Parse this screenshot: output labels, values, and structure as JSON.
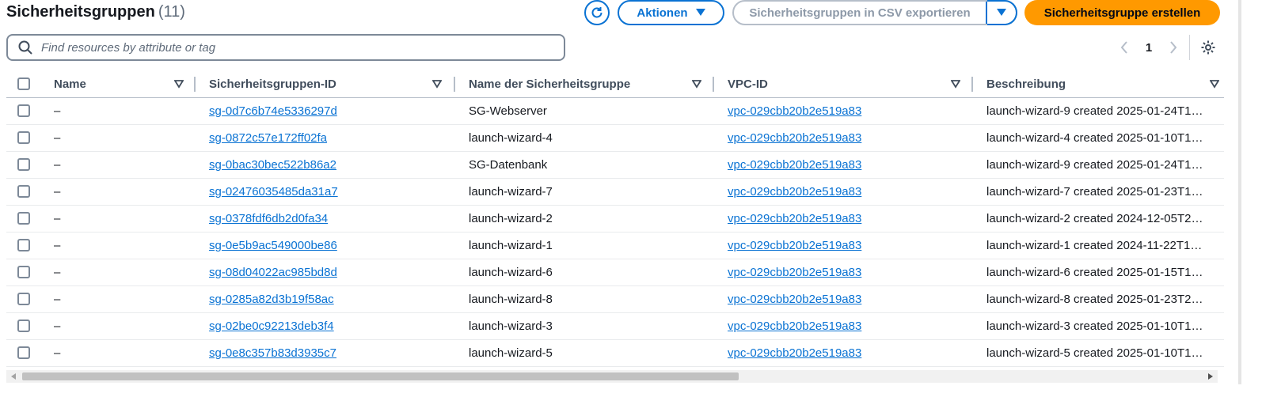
{
  "header": {
    "title": "Sicherheitsgruppen",
    "count": "(11)",
    "actions_label": "Aktionen",
    "export_label": "Sicherheitsgruppen in CSV exportieren",
    "create_label": "Sicherheitsgruppe erstellen"
  },
  "search": {
    "placeholder": "Find resources by attribute or tag"
  },
  "pagination": {
    "current_page": "1"
  },
  "columns": {
    "name": "Name",
    "sg_id": "Sicherheitsgruppen-ID",
    "sg_name": "Name der Sicherheitsgruppe",
    "vpc_id": "VPC-ID",
    "description": "Beschreibung"
  },
  "rows": [
    {
      "name": "–",
      "sg_id": "sg-0d7c6b74e5336297d",
      "sg_name": "SG-Webserver",
      "vpc_id": "vpc-029cbb20b2e519a83",
      "description": "launch-wizard-9 created 2025-01-24T1…"
    },
    {
      "name": "–",
      "sg_id": "sg-0872c57e172ff02fa",
      "sg_name": "launch-wizard-4",
      "vpc_id": "vpc-029cbb20b2e519a83",
      "description": "launch-wizard-4 created 2025-01-10T1…"
    },
    {
      "name": "–",
      "sg_id": "sg-0bac30bec522b86a2",
      "sg_name": "SG-Datenbank",
      "vpc_id": "vpc-029cbb20b2e519a83",
      "description": "launch-wizard-9 created 2025-01-24T1…"
    },
    {
      "name": "–",
      "sg_id": "sg-02476035485da31a7",
      "sg_name": "launch-wizard-7",
      "vpc_id": "vpc-029cbb20b2e519a83",
      "description": "launch-wizard-7 created 2025-01-23T1…"
    },
    {
      "name": "–",
      "sg_id": "sg-0378fdf6db2d0fa34",
      "sg_name": "launch-wizard-2",
      "vpc_id": "vpc-029cbb20b2e519a83",
      "description": "launch-wizard-2 created 2024-12-05T2…"
    },
    {
      "name": "–",
      "sg_id": "sg-0e5b9ac549000be86",
      "sg_name": "launch-wizard-1",
      "vpc_id": "vpc-029cbb20b2e519a83",
      "description": "launch-wizard-1 created 2024-11-22T1…"
    },
    {
      "name": "–",
      "sg_id": "sg-08d04022ac985bd8d",
      "sg_name": "launch-wizard-6",
      "vpc_id": "vpc-029cbb20b2e519a83",
      "description": "launch-wizard-6 created 2025-01-15T1…"
    },
    {
      "name": "–",
      "sg_id": "sg-0285a82d3b19f58ac",
      "sg_name": "launch-wizard-8",
      "vpc_id": "vpc-029cbb20b2e519a83",
      "description": "launch-wizard-8 created 2025-01-23T2…"
    },
    {
      "name": "–",
      "sg_id": "sg-02be0c92213deb3f4",
      "sg_name": "launch-wizard-3",
      "vpc_id": "vpc-029cbb20b2e519a83",
      "description": "launch-wizard-3 created 2025-01-10T1…"
    },
    {
      "name": "–",
      "sg_id": "sg-0e8c357b83d3935c7",
      "sg_name": "launch-wizard-5",
      "vpc_id": "vpc-029cbb20b2e519a83",
      "description": "launch-wizard-5 created 2025-01-10T1…"
    }
  ],
  "colors": {
    "link": "#0972d3",
    "primary_button": "#ff9900",
    "text": "#16191f",
    "muted": "#5f6b7a"
  }
}
